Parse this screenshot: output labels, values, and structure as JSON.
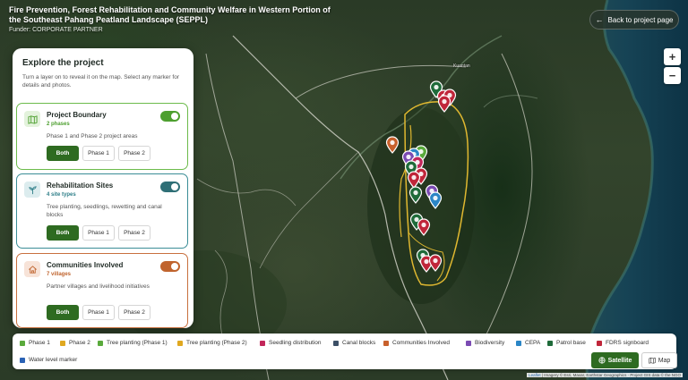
{
  "header": {
    "title": "Fire Prevention, Forest Rehabilitation and Community Welfare in Western Portion of the Southeast Pahang Peatland Landscape (SEPPL)",
    "funder": "Funder: CORPORATE PARTNER",
    "back_label": "Back to project page"
  },
  "zoom": {
    "in": "+",
    "out": "−"
  },
  "map_labels": {
    "town": "Kuantan"
  },
  "panel": {
    "title": "Explore the project",
    "intro": "Turn a layer on to reveal it on the map. Select any marker for details and photos.",
    "layers": [
      {
        "name": "Project Boundary",
        "count": "2 phases",
        "desc": "Phase 1 and Phase 2 project areas",
        "icon": "map-icon",
        "color": "#4d9f2f",
        "enabled": true
      },
      {
        "name": "Rehabilitation Sites",
        "count": "4 site types",
        "desc": "Tree planting, seedlings, rewetting and canal blocks",
        "icon": "sprout-icon",
        "color": "#2f6f76",
        "enabled": true
      },
      {
        "name": "Communities Involved",
        "count": "7 villages",
        "desc": "Partner villages and livelihood initiatives",
        "icon": "home-icon",
        "color": "#c0642e",
        "enabled": true
      }
    ],
    "filters": {
      "both": "Both",
      "phase1": "Phase 1",
      "phase2": "Phase 2",
      "selected": "Both"
    }
  },
  "legend": [
    {
      "label": "Phase 1",
      "color": "#5aaa3c"
    },
    {
      "label": "Phase 2",
      "color": "#e0a820"
    },
    {
      "label": "Tree planting (Phase 1)",
      "color": "#5aaa3c"
    },
    {
      "label": "Tree planting (Phase 2)",
      "color": "#e0a820"
    },
    {
      "label": "Seedling distribution",
      "color": "#c2275a"
    },
    {
      "label": "Canal blocks",
      "color": "#3c4f66"
    },
    {
      "label": "Communities Involved",
      "color": "#c8602c"
    },
    {
      "label": "Biodiversity",
      "color": "#7b4bb3"
    },
    {
      "label": "CEPA",
      "color": "#2b86c6"
    },
    {
      "label": "Patrol base",
      "color": "#1f6b3a"
    },
    {
      "label": "FDRS signboard",
      "color": "#c0263a"
    },
    {
      "label": "Water level marker",
      "color": "#2a62b5"
    }
  ],
  "basemap": {
    "satellite": "Satellite",
    "map": "Map",
    "active": "Satellite"
  },
  "attribution": {
    "leaflet": "Leaflet",
    "rest": " | Imagery © Esri, Maxar, Earthstar Geographics · Project GIS data © the NGO"
  },
  "colors": {
    "accent": "#2e6b21",
    "boundary": "#e0b830"
  }
}
